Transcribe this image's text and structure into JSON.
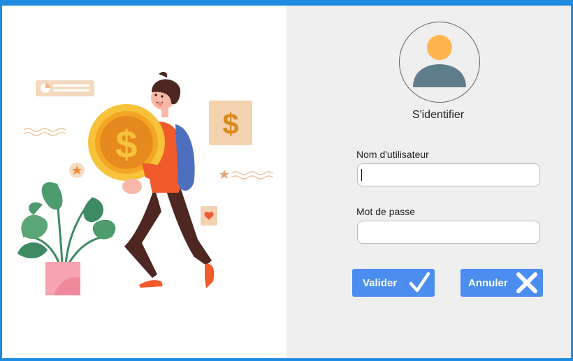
{
  "login": {
    "title": "S'identifier",
    "username_label": "Nom d'utilisateur",
    "username_value": "",
    "password_label": "Mot de passe",
    "password_value": "",
    "validate_label": "Valider",
    "cancel_label": "Annuler"
  },
  "icons": {
    "avatar": "user-avatar-icon",
    "validate": "check-icon",
    "cancel": "close-icon"
  },
  "colors": {
    "window_border": "#1f8be0",
    "button": "#4b8ef0",
    "login_panel": "#efefef",
    "avatar_head": "#ffb74d",
    "avatar_body": "#607d8b"
  }
}
